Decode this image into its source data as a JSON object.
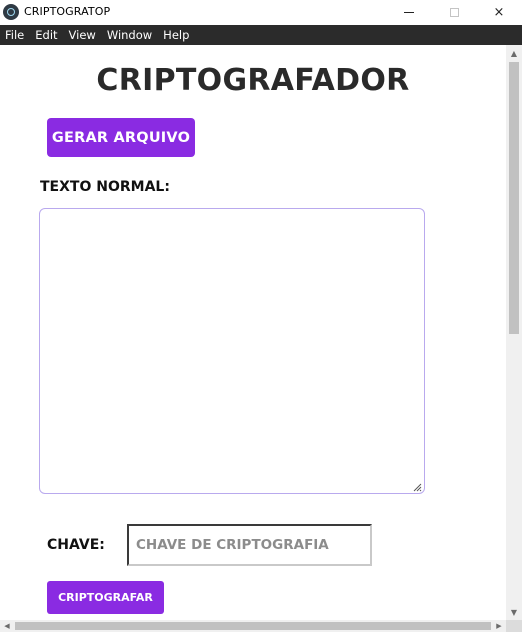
{
  "window": {
    "title": "CRIPTOGRATOP",
    "icon": "electron-atom-icon",
    "controls": {
      "minimize": "minimize-icon",
      "maximize": "maximize-icon",
      "close": "×"
    }
  },
  "menubar": {
    "items": [
      {
        "label": "File"
      },
      {
        "label": "Edit"
      },
      {
        "label": "View"
      },
      {
        "label": "Window"
      },
      {
        "label": "Help"
      }
    ]
  },
  "main": {
    "heading": "CRIPTOGRAFADOR",
    "generate_button": "GERAR ARQUIVO",
    "text_label": "TEXTO NORMAL:",
    "text_value": "",
    "key_label": "CHAVE:",
    "key_placeholder": "CHAVE DE CRIPTOGRAFIA",
    "key_value": "",
    "encrypt_button": "CRIPTOGRAFAR"
  },
  "colors": {
    "accent": "#8a2be2",
    "menubar_bg": "#2b2b2b",
    "heading_text": "#2a2a2a",
    "textarea_border": "#b9a9ee"
  }
}
